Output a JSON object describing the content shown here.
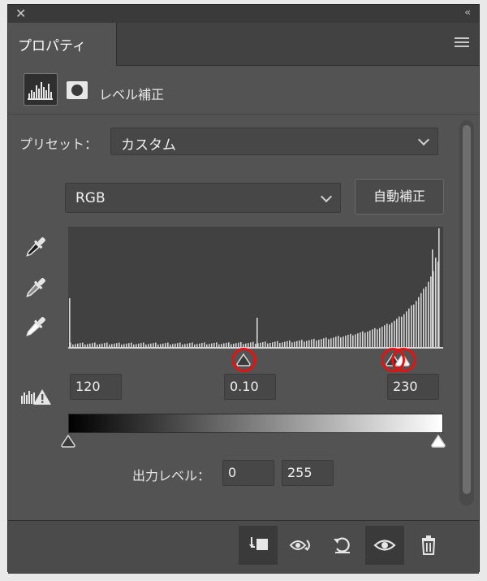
{
  "panel": {
    "tab_label": "プロパティ",
    "adjustment_title": "レベル補正"
  },
  "preset": {
    "label": "プリセット：",
    "value": "カスタム"
  },
  "channel": {
    "value": "RGB",
    "auto_button": "自動補正"
  },
  "input_levels": {
    "black": "120",
    "gamma": "0.10",
    "white": "230"
  },
  "output_levels": {
    "label": "出力レベル：",
    "black": "0",
    "white": "255"
  },
  "icons": [
    "close-icon",
    "collapse-icon",
    "panel-menu-icon",
    "levels-icon",
    "mask-icon",
    "black-point-eyedropper-icon",
    "gray-point-eyedropper-icon",
    "white-point-eyedropper-icon",
    "clipping-warning-icon",
    "clip-to-layer-icon",
    "view-previous-state-icon",
    "reset-icon",
    "visibility-eye-icon",
    "trash-icon"
  ],
  "colors": {
    "panel_bg": "#535353",
    "titlebar_bg": "#3a3a3a",
    "highlight_ring": "#e81010"
  }
}
